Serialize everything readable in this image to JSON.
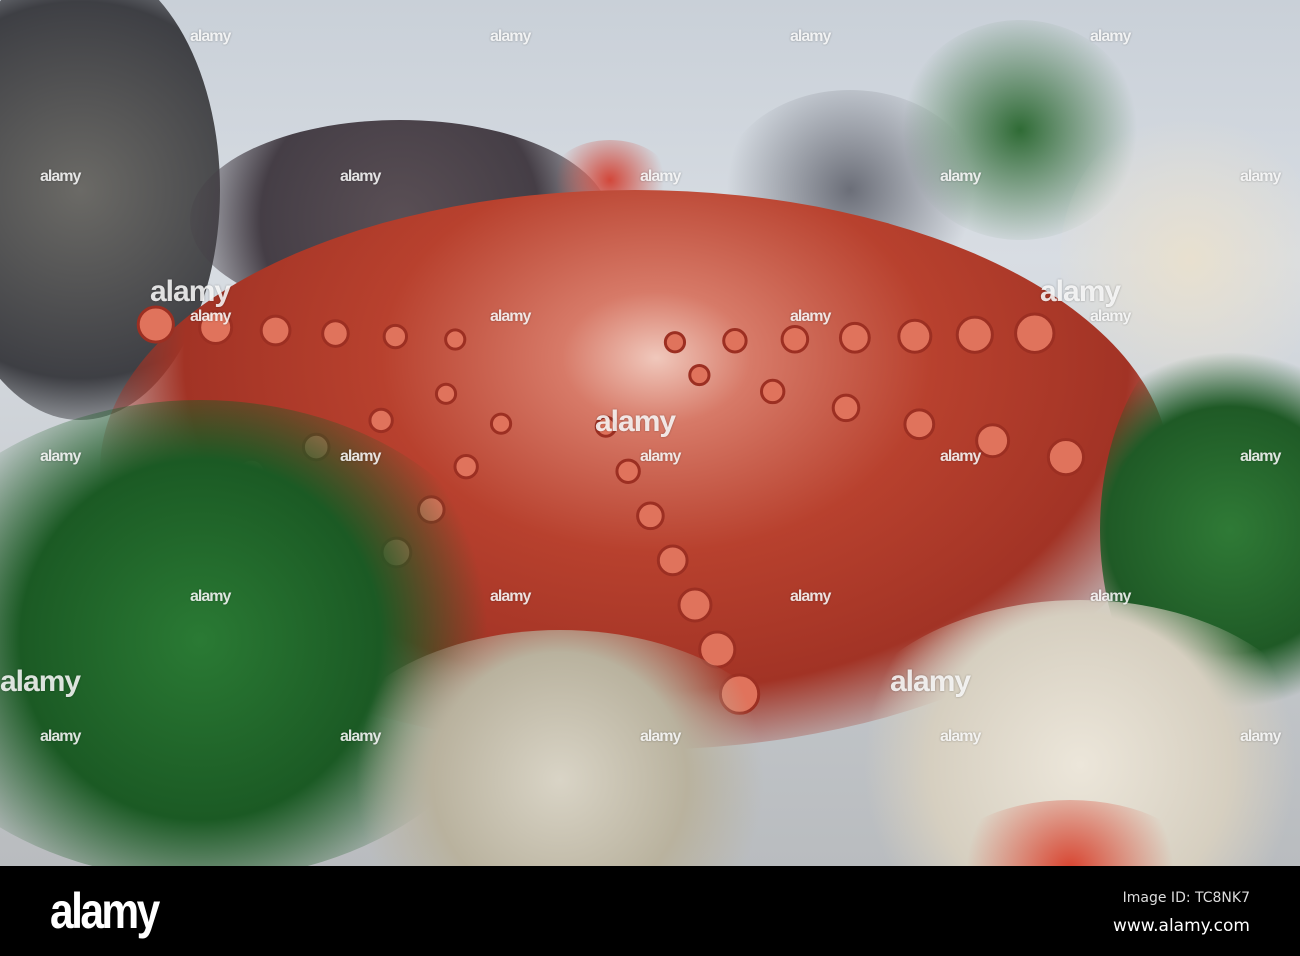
{
  "watermark": "alamy",
  "footer": {
    "logo": "alamy",
    "image_id": "Image ID: TC8NK7",
    "website": "www.alamy.com"
  },
  "colors": {
    "octopus": "#b8412e",
    "parsley": "#1f5a2a",
    "background": "#d2d7dc"
  }
}
